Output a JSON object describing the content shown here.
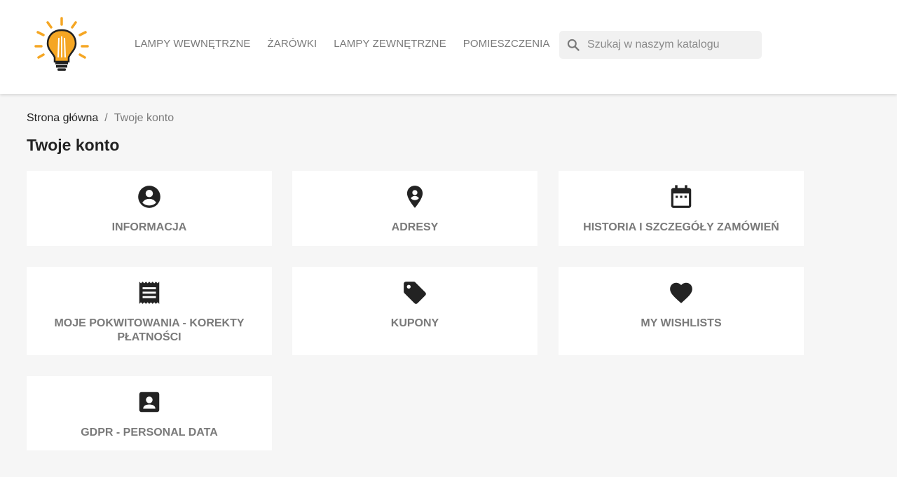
{
  "header": {
    "nav": [
      {
        "label": "LAMPY WEWNĘTRZNE"
      },
      {
        "label": "ŻARÓWKI"
      },
      {
        "label": "LAMPY ZEWNĘTRZNE"
      },
      {
        "label": "POMIESZCZENIA"
      }
    ],
    "search": {
      "placeholder": "Szukaj w naszym katalogu",
      "value": ""
    },
    "logo_icon": "lightbulb-logo",
    "accent_color": "#f5a623"
  },
  "breadcrumb": {
    "home": "Strona główna",
    "separator": "/",
    "current": "Twoje konto"
  },
  "page": {
    "title": "Twoje konto"
  },
  "cards": [
    {
      "label": "INFORMACJA",
      "icon": "account-circle-icon"
    },
    {
      "label": "ADRESY",
      "icon": "location-pin-icon"
    },
    {
      "label": "HISTORIA I SZCZEGÓŁY ZAMÓWIEŃ",
      "icon": "calendar-icon"
    },
    {
      "label": "MOJE POKWITOWANIA - KOREKTY PŁATNOŚCI",
      "icon": "receipt-icon"
    },
    {
      "label": "KUPONY",
      "icon": "tag-icon"
    },
    {
      "label": "MY WISHLISTS",
      "icon": "heart-icon"
    },
    {
      "label": "GDPR - PERSONAL DATA",
      "icon": "contact-card-icon"
    }
  ]
}
